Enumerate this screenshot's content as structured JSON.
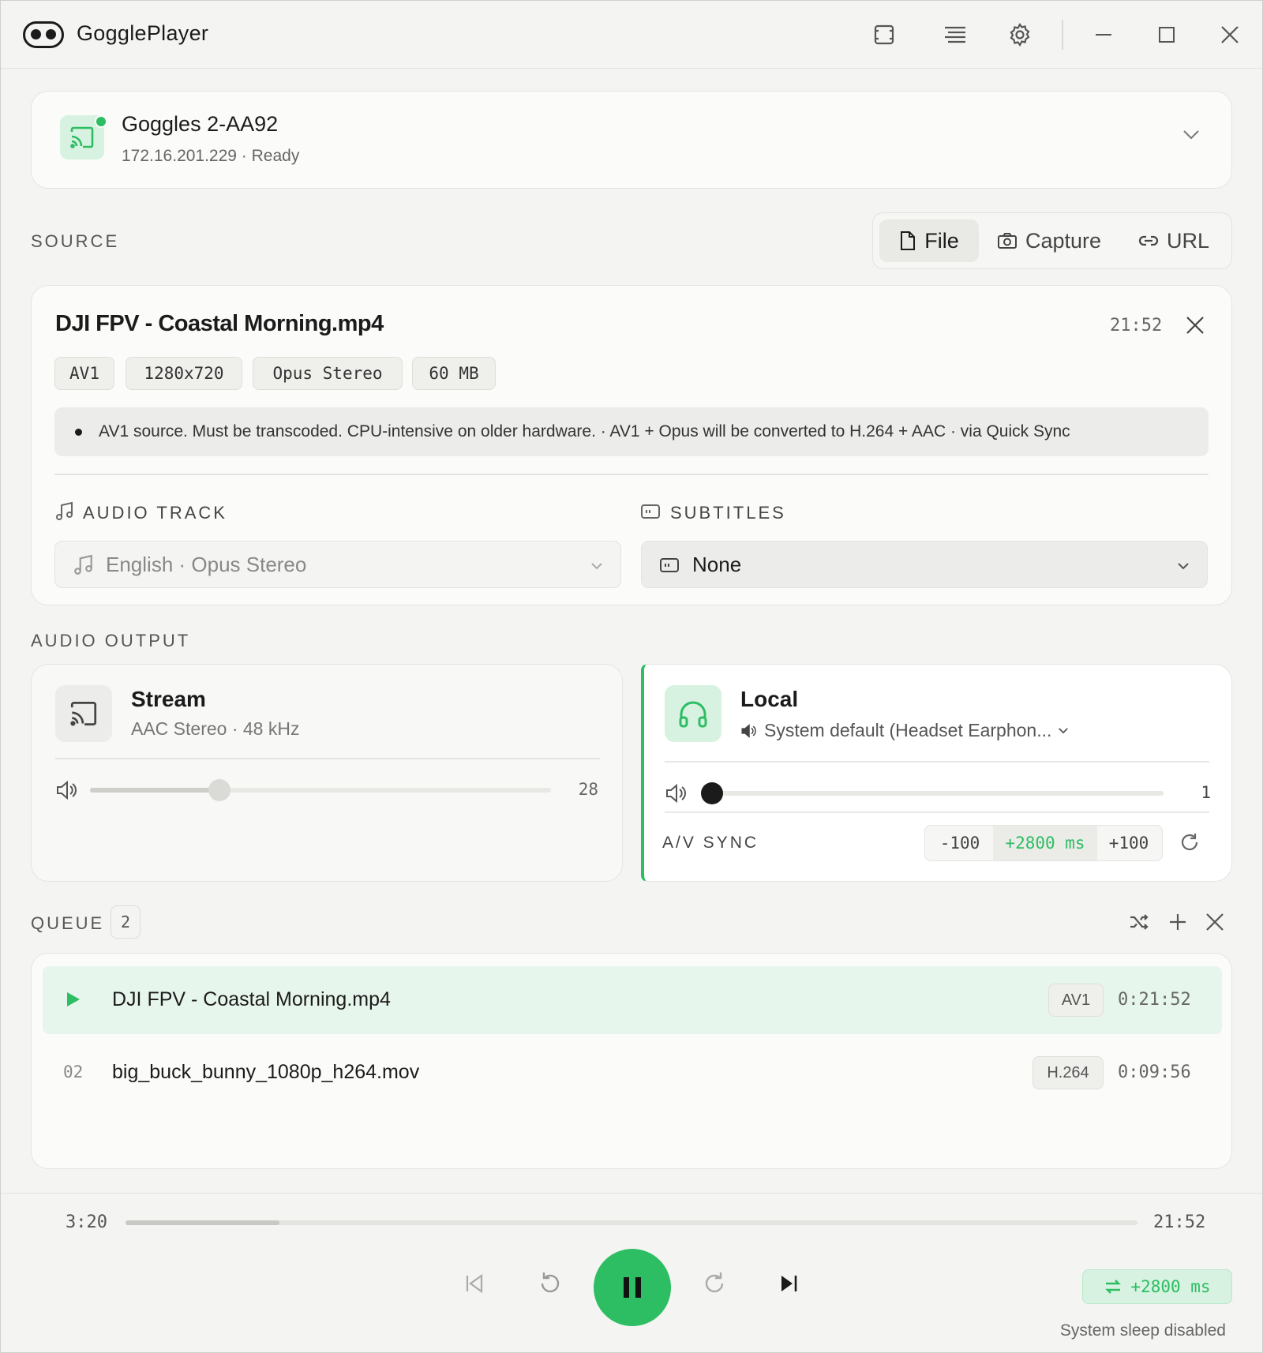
{
  "app": {
    "title": "GogglePlayer"
  },
  "device": {
    "name": "Goggles 2-AA92",
    "status": "172.16.201.229 · Ready"
  },
  "source": {
    "label": "SOURCE",
    "tabs": [
      {
        "label": "File",
        "active": true
      },
      {
        "label": "Capture",
        "active": false
      },
      {
        "label": "URL",
        "active": false
      }
    ]
  },
  "file": {
    "name": "DJI FPV - Coastal Morning.mp4",
    "duration": "21:52",
    "chips": [
      "AV1",
      "1280x720",
      "Opus Stereo",
      "60 MB"
    ],
    "notice": "AV1 source. Must be transcoded. CPU-intensive on older hardware. · AV1 + Opus will be converted to H.264 + AAC · via Quick Sync",
    "audio_track": {
      "label": "AUDIO TRACK",
      "value": "English · Opus Stereo"
    },
    "subtitles": {
      "label": "SUBTITLES",
      "value": "None"
    }
  },
  "audio_output": {
    "label": "AUDIO OUTPUT",
    "stream": {
      "title": "Stream",
      "subtitle": "AAC Stereo · 48 kHz",
      "volume": 28
    },
    "local": {
      "title": "Local",
      "device": "System default (Headset Earphon...",
      "volume": 1
    },
    "av_sync": {
      "label": "A/V SYNC",
      "minus": "-100",
      "value": "+2800 ms",
      "plus": "+100"
    }
  },
  "queue": {
    "label": "QUEUE",
    "count": "2",
    "items": [
      {
        "index": "",
        "name": "DJI FPV - Coastal Morning.mp4",
        "codec": "AV1",
        "duration": "0:21:52",
        "playing": true
      },
      {
        "index": "02",
        "name": "big_buck_bunny_1080p_h264.mov",
        "codec": "H.264",
        "duration": "0:09:56",
        "playing": false
      }
    ]
  },
  "player": {
    "elapsed": "3:20",
    "total": "21:52",
    "progress": 0.152,
    "sync_badge": "+2800 ms",
    "status": "System sleep disabled"
  },
  "colors": {
    "accent": "#2dbd63",
    "accent_light": "#d7f2e0",
    "text": "#1b1b1b"
  }
}
